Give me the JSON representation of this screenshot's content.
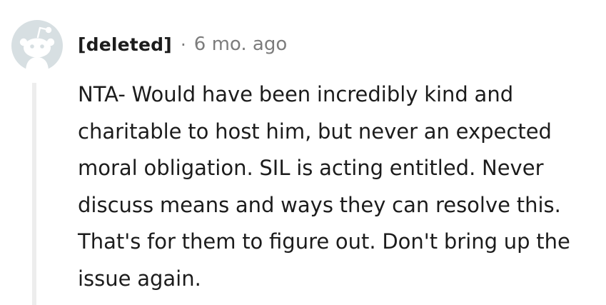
{
  "comment": {
    "author": "[deleted]",
    "separator": "·",
    "timestamp": "6 mo. ago",
    "avatar_icon": "snoo-avatar-icon",
    "avatar_color": "#d7dfe2",
    "text": "NTA- Would have been incredibly kind and charitable to host him, but never an expected moral obligation. SIL is acting entitled. Never discuss means and ways they can resolve this. That's for them to figure out. Don't bring up the issue again."
  }
}
